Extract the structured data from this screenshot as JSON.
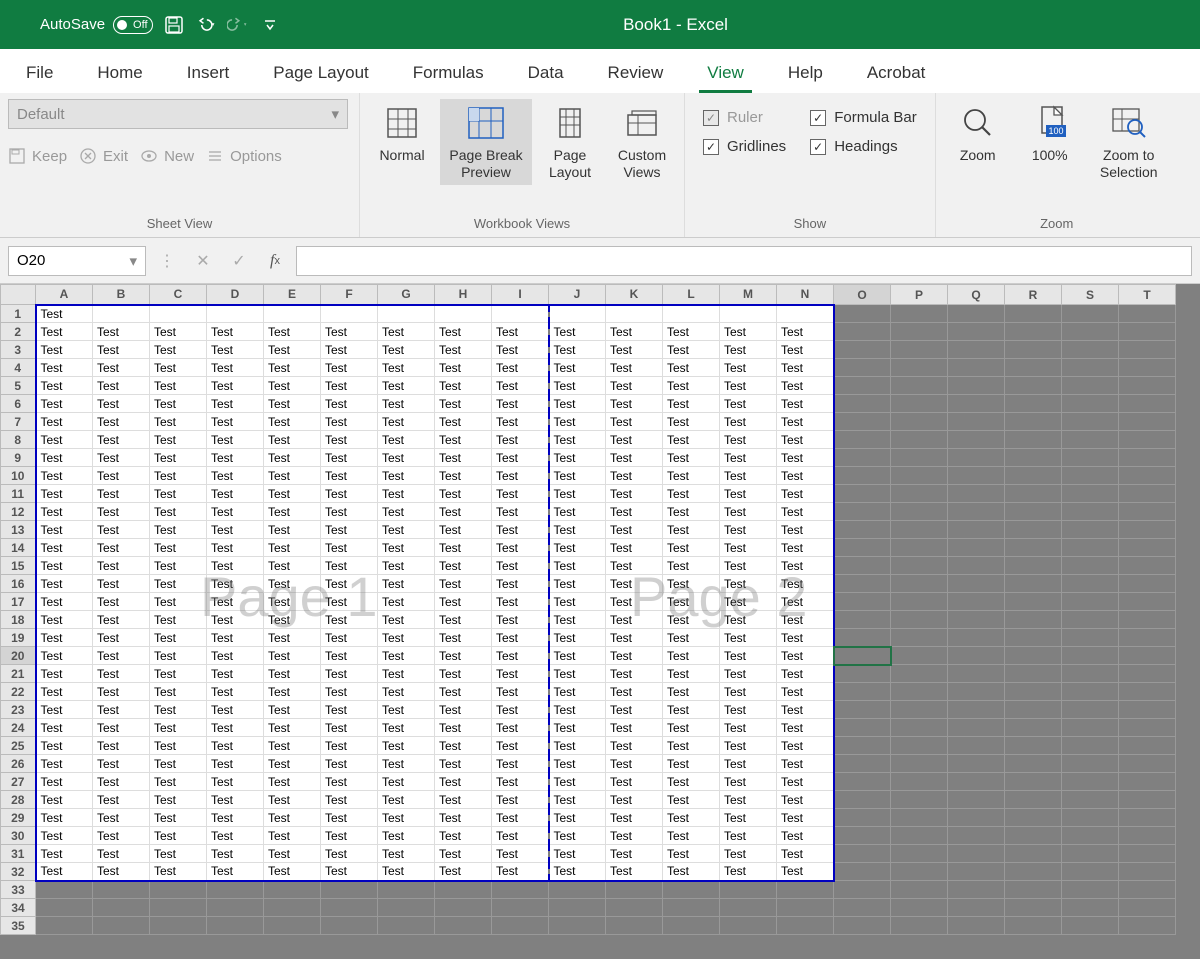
{
  "titlebar": {
    "autosave_label": "AutoSave",
    "autosave_state": "Off",
    "title": "Book1 - Excel"
  },
  "tabs": [
    "File",
    "Home",
    "Insert",
    "Page Layout",
    "Formulas",
    "Data",
    "Review",
    "View",
    "Help",
    "Acrobat"
  ],
  "active_tab": "View",
  "ribbon": {
    "sheetview": {
      "dropdown": "Default",
      "keep": "Keep",
      "exit": "Exit",
      "new": "New",
      "options": "Options",
      "group_label": "Sheet View"
    },
    "workbook_views": {
      "normal": "Normal",
      "pagebreak": "Page Break Preview",
      "pagelayout": "Page Layout",
      "custom": "Custom Views",
      "group_label": "Workbook Views"
    },
    "show": {
      "ruler": "Ruler",
      "gridlines": "Gridlines",
      "formula_bar": "Formula Bar",
      "headings": "Headings",
      "group_label": "Show"
    },
    "zoom": {
      "zoom": "Zoom",
      "p100": "100%",
      "zoom_sel": "Zoom to Selection",
      "group_label": "Zoom"
    }
  },
  "formula_bar": {
    "name_box": "O20",
    "formula": ""
  },
  "grid": {
    "columns": [
      "A",
      "B",
      "C",
      "D",
      "E",
      "F",
      "G",
      "H",
      "I",
      "J",
      "K",
      "L",
      "M",
      "N",
      "O",
      "P",
      "Q",
      "R",
      "S",
      "T"
    ],
    "row_count": 35,
    "data_last_col": 14,
    "data_last_row": 32,
    "page_break_after_col": 9,
    "selected_cell": {
      "row": 20,
      "col": 15
    },
    "cell_value_row1": "Test",
    "cell_value": "Test",
    "watermarks": [
      "Page 1",
      "Page 2"
    ]
  }
}
